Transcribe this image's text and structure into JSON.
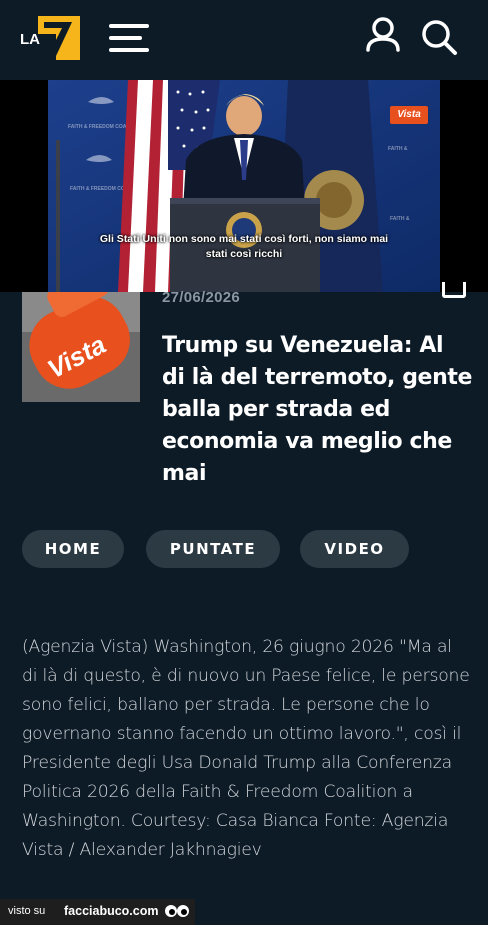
{
  "header": {
    "logo_text": "LA 7",
    "icons": {
      "menu": "hamburger-menu-icon",
      "user": "user-icon",
      "search": "search-icon"
    }
  },
  "video": {
    "subtitle_line1": "Gli Stati Uniti non sono mai stati così forti, non siamo mai",
    "subtitle_line2": "stati così ricchi",
    "badge": "Vista"
  },
  "article": {
    "date": "27/06/2026",
    "title": "Trump su Venezuela: Al di là del terremoto, gente balla per strada ed economia va meglio che mai",
    "thumbnail_text": "Vista"
  },
  "nav_pills": [
    {
      "label": "HOME"
    },
    {
      "label": "PUNTATE"
    },
    {
      "label": "VIDEO"
    }
  ],
  "body": "(Agenzia Vista) Washington, 26 giugno 2026 \"Ma al di là di questo, è di nuovo un Paese felice, le persone sono felici, ballano per strada. Le persone che lo governano stanno facendo un ottimo lavoro.\", così il Presidente degli Usa Donald Trump alla Conferenza Politica 2026 della Faith & Freedom Coalition a Washington. Courtesy: Casa Bianca Fonte: Agenzia Vista / Alexander Jakhnagiev",
  "watermark": {
    "prefix": "visto su",
    "site": "facciabuco.com"
  },
  "colors": {
    "background": "#0d1b27",
    "pill": "#2c3a44",
    "logo_yellow": "#f5b51b",
    "vista_orange": "#e8501e"
  }
}
